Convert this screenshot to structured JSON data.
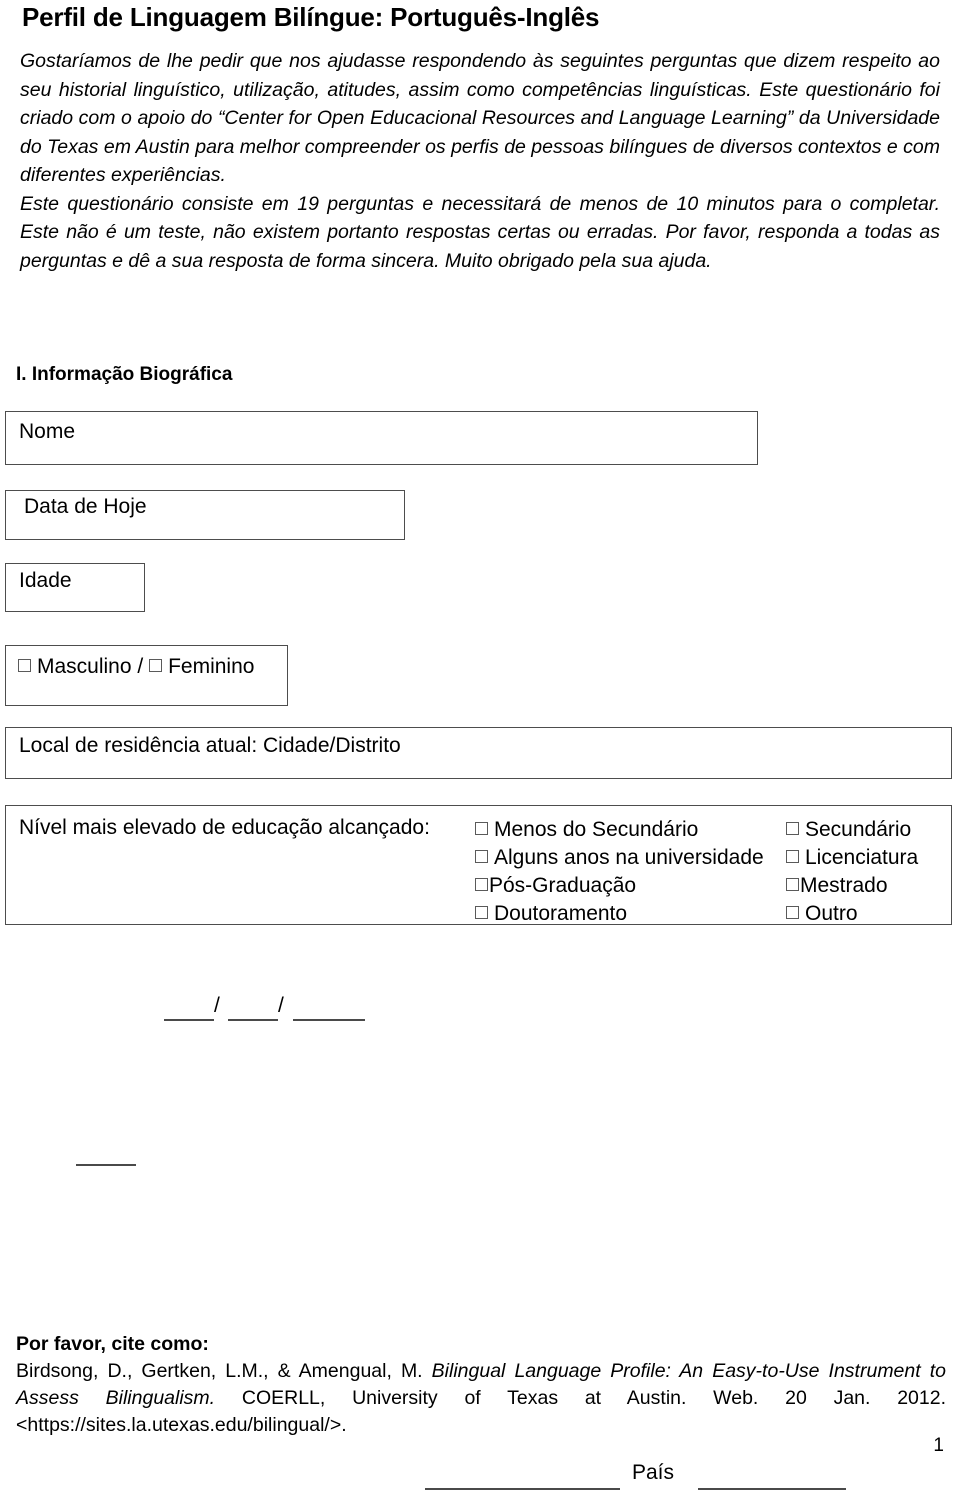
{
  "document": {
    "title": "Perfil de Linguagem Bilíngue: Português-Inglês",
    "intro_paragraph_1": "Gostaríamos de lhe pedir que nos ajudasse respondendo às seguintes perguntas que dizem respeito ao seu historial linguístico, utilização, atitudes, assim como competências linguísticas. Este questionário foi criado com o apoio do “Center for Open Educacional Resources and Language Learning” da Universidade do Texas em Austin para melhor compreender os perfis de pessoas bilíngues de diversos contextos e com diferentes experiências.",
    "intro_paragraph_2": "Este questionário consiste em 19 perguntas e necessitará de menos de 10 minutos para o completar. Este não é um teste, não existem portanto respostas certas ou erradas. Por favor, responda a todas as perguntas e dê a sua resposta de forma sincera. Muito obrigado pela sua ajuda.",
    "page_number": "1"
  },
  "section_one": {
    "heading": "I. Informação Biográfica",
    "name_field": {
      "label": "Nome"
    },
    "date_field": {
      "label": "Data de Hoje",
      "separator_1": "/",
      "separator_2": "/"
    },
    "age_field": {
      "label": "Idade"
    },
    "gender_field": {
      "male_label": "Masculino",
      "divider": "/",
      "female_label": "Feminino"
    },
    "residence_field": {
      "label": "Local de residência atual: Cidade/Distrito",
      "country_label": "País"
    },
    "education_field": {
      "prompt": "Nível mais elevado de educação alcançado:",
      "left_options": [
        "Menos do Secundário",
        "Alguns anos na universidade",
        "Pós-Graduação",
        "Doutoramento"
      ],
      "right_options": [
        "Secundário",
        "Licenciatura",
        "Mestrado",
        "Outro"
      ]
    }
  },
  "footer": {
    "cite_heading": "Por favor, cite como:",
    "cite_authors": "Birdsong, D., Gertken, L.M., & Amengual, M. ",
    "cite_work_italic": "Bilingual Language Profile: An Easy-to-Use Instrument to Assess Bilingualism.",
    "cite_rest": " COERLL, University of Texas at Austin. Web. 20 Jan. 2012. <https://sites.la.utexas.edu/bilingual/>."
  }
}
